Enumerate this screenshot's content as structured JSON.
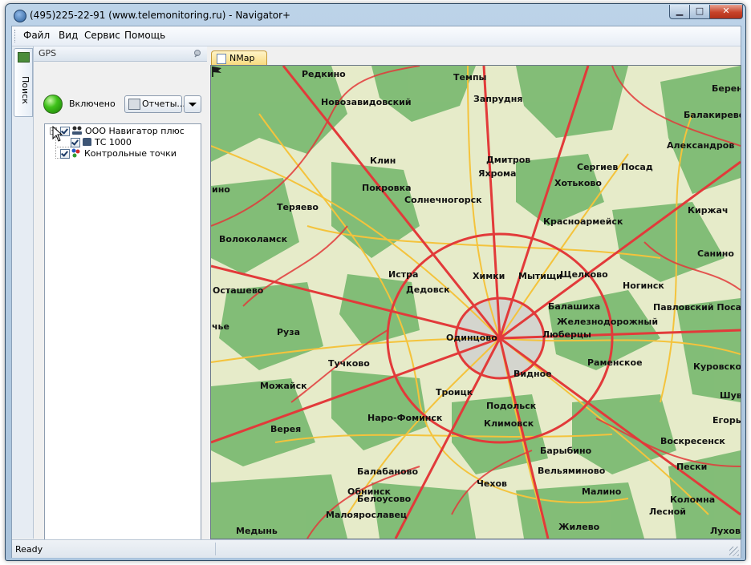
{
  "window": {
    "title": "(495)225-22-91  (www.telemonitoring.ru) - Navigator+",
    "minimize": "▁",
    "maximize": "□",
    "close": "✕"
  },
  "menu": [
    "Файл",
    "Вид",
    "Сервис",
    "Помощь"
  ],
  "side_tab": {
    "label": "Поиск",
    "icon": "search-panel-icon"
  },
  "gps_panel": {
    "title": "GPS",
    "status": "Включено",
    "status_color": "#3fc21a",
    "reports_button": "Отчеты...",
    "tree": [
      {
        "label": "ООО Навигатор плюс",
        "checked": true,
        "expanded": true,
        "icon": "organization-icon"
      },
      {
        "label": "ТС 1000",
        "checked": true,
        "icon": "car-icon"
      },
      {
        "label": "Контрольные точки",
        "checked": true,
        "icon": "control-points-icon"
      }
    ]
  },
  "doc_tab": {
    "label": "NMap"
  },
  "map": {
    "colors": {
      "forest": "#7dbb73",
      "field": "#e6ebc9",
      "road_major": "#e23a3a",
      "road_minor": "#f4c33c",
      "city": "#c8c8c8"
    },
    "places": [
      "Редкино",
      "Темпы",
      "Запрудня",
      "Берен",
      "Новозавидовский",
      "Балакирево",
      "Клин",
      "Дмитров",
      "Яхрома",
      "Сергиев Посад",
      "Александров",
      "Хотьково",
      "Покровка",
      "Солнечногорск",
      "ино",
      "Теряево",
      "Красноармейск",
      "Киржач",
      "Волоколамск",
      "Истра",
      "Химки",
      "Мытищи",
      "Щелково",
      "Санино",
      "Осташево",
      "Дедовск",
      "Ногинск",
      "Балашиха",
      "Павловский Посад",
      "Железнодорожный",
      "чье",
      "Руза",
      "Одинцово",
      "Люберцы",
      "Раменское",
      "Тучково",
      "Видное",
      "Куровское",
      "Можайск",
      "Троицк",
      "Шуво",
      "Подольск",
      "Верея",
      "Наро-Фоминск",
      "Климовск",
      "Егорье",
      "Барыбино",
      "Воскресенск",
      "Вельяминово",
      "Балабаново",
      "Пески",
      "Чехов",
      "Обнинск",
      "Белоусово",
      "Малино",
      "Коломна",
      "Малоярославец",
      "Лесной",
      "Медынь",
      "Жилево",
      "Луховь"
    ]
  },
  "statusbar": {
    "text": "Ready"
  }
}
